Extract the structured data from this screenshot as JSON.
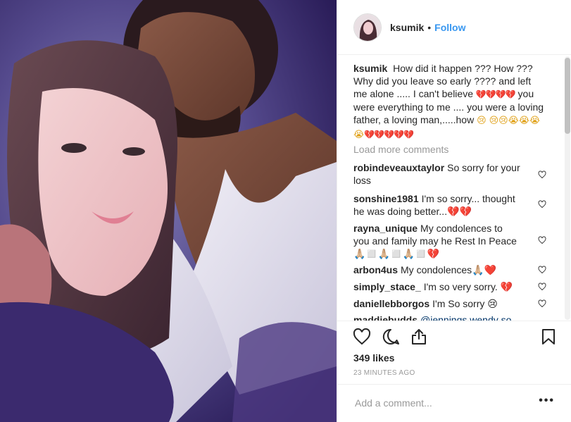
{
  "post": {
    "username": "ksumik",
    "separator": "•",
    "follow_label": "Follow",
    "caption_username": "ksumik",
    "caption_text": "How did it happen ??? How ??? Why did you leave so early ???? and left me alone ..... I can't believe",
    "caption_broken_1": "💔💔💔💔",
    "caption_text_2": "you were everything to me .... you were a loving father, a loving man,.....how",
    "caption_cry_1": "😢",
    "caption_cry_2": "😢😢😭😭😭😭",
    "caption_broken_2": "💔💔💔💔💔",
    "load_more": "Load more comments",
    "likes": "349 likes",
    "timestamp": "23 MINUTES AGO",
    "add_comment_placeholder": "Add a comment...",
    "more_options": "•••"
  },
  "comments": [
    {
      "user": "robindeveauxtaylor",
      "text": "So sorry for your loss"
    },
    {
      "user": "sonshine1981",
      "text": "I'm so sorry... thought he was doing better...💔💔"
    },
    {
      "user": "rayna_unique",
      "text": "My condolences to you and family may he Rest In Peace 🙏🏼◻️🙏🏼◻️🙏🏼◻️💔"
    },
    {
      "user": "arbon4us",
      "text": "My condolences🙏🏼❤️"
    },
    {
      "user": "simply_stace_",
      "text": "I'm so very sorry. 💔"
    },
    {
      "user": "daniellebborgos",
      "text": "I'm So sorry 😢"
    },
    {
      "user": "maddiebudds",
      "text": "@jennings.wendy so"
    }
  ],
  "icons": {
    "like": "heart-icon",
    "comment": "comment-icon",
    "share": "share-icon",
    "save": "bookmark-icon",
    "comment_like": "heart-icon"
  },
  "colors": {
    "follow": "#3897f0",
    "broken_heart": "#d8262e",
    "muted": "#999999"
  }
}
